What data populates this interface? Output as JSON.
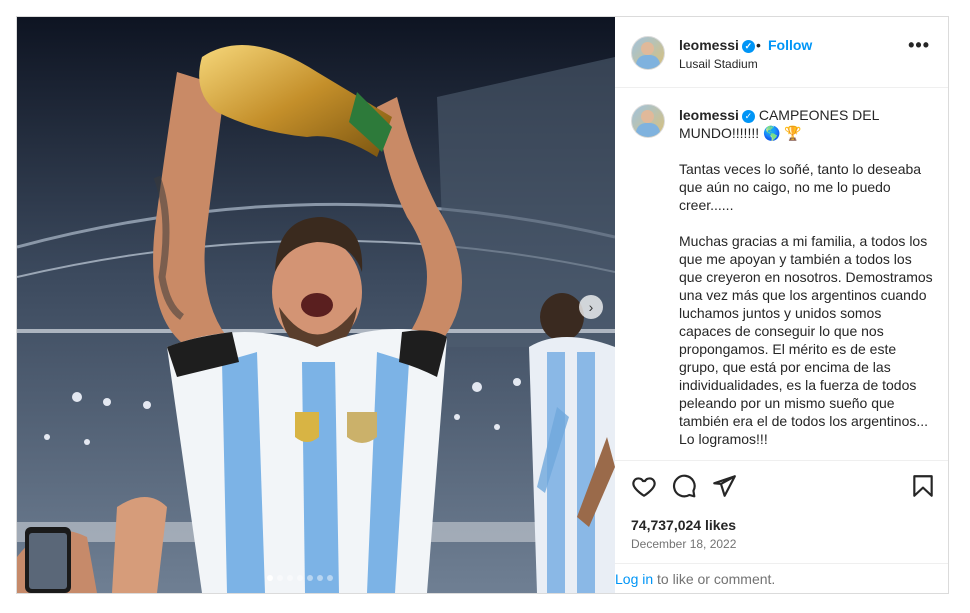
{
  "post": {
    "username": "leomessi",
    "follow_label": "Follow",
    "separator": "•",
    "location": "Lusail Stadium",
    "more_glyph": "•••",
    "caption_text": "CAMPEONES DEL MUNDO!!!!!!! 🌎 🏆\n\nTantas veces lo soñé, tanto lo deseaba que aún no caigo, no me lo puedo creer......\n\nMuchas gracias a mi familia, a todos los que me apoyan y también a todos los que creyeron en nosotros. Demostramos una vez más que los argentinos cuando luchamos juntos y unidos somos capaces de conseguir lo que nos propongamos. El mérito es de este grupo, que está por encima de las individualidades, es la fuerza de todos peleando por un mismo sueño que también era el de todos los argentinos... Lo logramos!!!",
    "likes": "74,737,024 likes",
    "date": "December 18, 2022",
    "login_link": "Log in",
    "login_suffix": " to like or comment."
  },
  "icons": {
    "verified": "verified-badge-icon",
    "like": "heart-icon",
    "comment": "comment-icon",
    "share": "share-icon",
    "save": "bookmark-icon",
    "next": "chevron-right-icon"
  },
  "colors": {
    "link": "#0095f6",
    "text": "#262626",
    "muted": "#737373",
    "border": "#dbdbdb"
  },
  "carousel": {
    "slides": 7,
    "active_index": 0
  }
}
